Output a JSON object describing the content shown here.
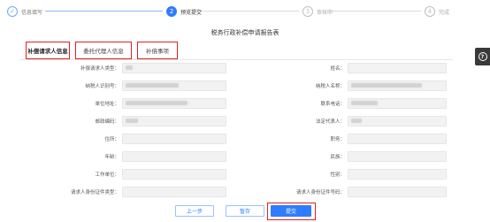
{
  "stepper": {
    "steps": [
      {
        "label": "信息填写",
        "state": "done",
        "marker": "✓"
      },
      {
        "label": "预览提交",
        "state": "active",
        "marker": "2"
      },
      {
        "label": "审核中",
        "state": "pending",
        "marker": "3"
      },
      {
        "label": "完成",
        "state": "pending",
        "marker": "4"
      }
    ]
  },
  "form": {
    "title": "税务行政补偿申请报告表",
    "tabs": [
      {
        "label": "补偿请求人信息",
        "active": true
      },
      {
        "label": "委托代理人信息",
        "active": false
      },
      {
        "label": "补偿事项",
        "active": false
      }
    ],
    "rows": [
      {
        "left": {
          "label": "补偿请求人类型："
        },
        "right": {
          "label": "姓名："
        }
      },
      {
        "left": {
          "label": "纳税人识别号："
        },
        "right": {
          "label": "纳税人名称："
        }
      },
      {
        "left": {
          "label": "单位地址："
        },
        "right": {
          "label": "联系电话："
        }
      },
      {
        "left": {
          "label": "邮政编码："
        },
        "right": {
          "label": "法定代表人："
        }
      },
      {
        "left": {
          "label": "住所："
        },
        "right": {
          "label": "职务："
        }
      },
      {
        "left": {
          "label": "年龄："
        },
        "right": {
          "label": "民族："
        }
      },
      {
        "left": {
          "label": "工作单位："
        },
        "right": {
          "label": "性别："
        }
      },
      {
        "left": {
          "label": "请求人身份证件类型："
        },
        "right": {
          "label": "请求人身份证件号码："
        }
      }
    ]
  },
  "buttons": {
    "prev": "上一步",
    "save": "暂存",
    "submit": "提交"
  },
  "side": {
    "help_icon": "question-icon",
    "help_glyph": "?"
  },
  "colors": {
    "primary": "#2f7cff",
    "highlight": "#e02020"
  }
}
